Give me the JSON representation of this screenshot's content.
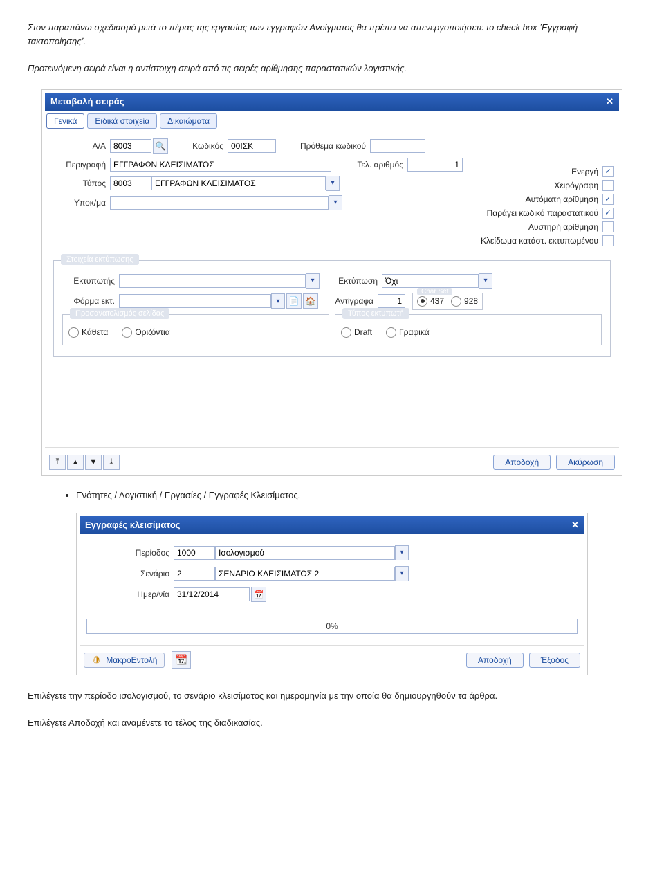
{
  "doc": {
    "intro1": "Στον παραπάνω σχεδιασμό μετά το πέρας της εργασίας των εγγραφών Ανοίγματος θα πρέπει να απενεργοποιήσετε το check box ʽΕγγραφή τακτοποίησηςʼ.",
    "intro2": "Προτεινόμενη σειρά είναι η αντίστοιχη σειρά από τις σειρές αρίθμησης παραστατικών λογιστικής.",
    "bullet1": "Ενότητες / Λογιστική / Εργασίες / Εγγραφές Κλεισίματος.",
    "outro1": "Επιλέγετε την περίοδο ισολογισμού, το σενάριο κλεισίματος και ημερομηνία με την οποία θα δημιουργηθούν τα άρθρα.",
    "outro2": "Επιλέγετε Αποδοχή  και αναμένετε το τέλος της διαδικασίας."
  },
  "dialog1": {
    "title": "Μεταβολή σειράς",
    "tabs": {
      "general": "Γενικά",
      "special": "Ειδικά στοιχεία",
      "rights": "Δικαιώματα"
    },
    "labels": {
      "aa": "Α/Α",
      "code": "Κωδικός",
      "prefix": "Πρόθεμα κωδικού",
      "desc": "Περιγραφή",
      "lastnum": "Τελ. αριθμός",
      "type": "Τύπος",
      "branch": "Υποκ/μα",
      "active": "Ενεργή",
      "manual": "Χειρόγραφη",
      "autonum": "Αυτόματη αρίθμηση",
      "gencode": "Παράγει κωδικό παραστατικού",
      "strict": "Αυστηρή αρίθμηση",
      "lockprint": "Κλείδωμα κατάστ. εκτυπωμένου",
      "printgroup": "Στοιχεία εκτύπωσης",
      "printer": "Εκτυπωτής",
      "print": "Εκτύπωση",
      "form": "Φόρμα εκτ.",
      "copies": "Αντίγραφα",
      "charset": "Char Set",
      "orientation": "Προσανατολισμός σελίδας",
      "vert": "Κάθετα",
      "horz": "Οριζόντια",
      "printertype": "Τύπος εκτυπωτή",
      "draft": "Draft",
      "graphics": "Γραφικά"
    },
    "values": {
      "aa": "8003",
      "code": "00ΙΣΚ",
      "prefix": "",
      "desc": "ΕΓΓΡΑΦΩΝ ΚΛΕΙΣΙΜΑΤΟΣ",
      "lastnum": "1",
      "typecode": "8003",
      "typedesc": "ΕΓΓΡΑΦΩΝ ΚΛΕΙΣΙΜΑΤΟΣ",
      "branch": "",
      "active": true,
      "manual": false,
      "autonum": true,
      "gencode": true,
      "strict": false,
      "lockprint": false,
      "printer": "",
      "print": "Όχι",
      "form": "",
      "copies": "1",
      "charset437": true,
      "charset928": false,
      "cs437": "437",
      "cs928": "928"
    },
    "buttons": {
      "accept": "Αποδοχή",
      "cancel": "Ακύρωση"
    }
  },
  "dialog2": {
    "title": "Εγγραφές κλεισίματος",
    "labels": {
      "period": "Περίοδος",
      "scenario": "Σενάριο",
      "date": "Ημερ/νία"
    },
    "values": {
      "periodcode": "1000",
      "perioddesc": "Ισολογισμού",
      "scenariocode": "2",
      "scenariodesc": "ΣΕΝΑΡΙΟ ΚΛΕΙΣΙΜΑΤΟΣ 2",
      "date": "31/12/2014",
      "progress": "0%"
    },
    "buttons": {
      "macro": "ΜακροΕντολή",
      "accept": "Αποδοχή",
      "exit": "Έξοδος"
    }
  }
}
